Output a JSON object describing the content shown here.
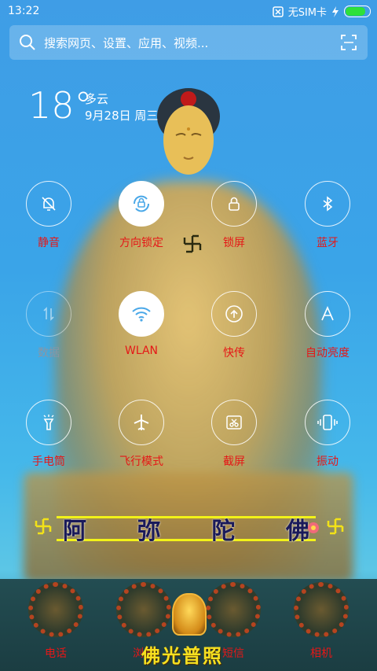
{
  "status_bar": {
    "time": "13:22",
    "sim": "无SIM卡",
    "battery_level": 0.9
  },
  "search": {
    "placeholder": "搜索网页、设置、应用、视频..."
  },
  "weather": {
    "temperature": "18°",
    "condition": "多云",
    "date": "9月28日 周三"
  },
  "toggles": [
    {
      "label": "静音",
      "icon": "bell-off-icon",
      "on": false
    },
    {
      "label": "方向锁定",
      "icon": "rotation-lock-icon",
      "on": true
    },
    {
      "label": "锁屏",
      "icon": "lock-icon",
      "on": false
    },
    {
      "label": "蓝牙",
      "icon": "bluetooth-icon",
      "on": false
    },
    {
      "label": "数据",
      "icon": "data-arrows-icon",
      "on": false
    },
    {
      "label": "WLAN",
      "icon": "wifi-icon",
      "on": true
    },
    {
      "label": "快传",
      "icon": "upload-icon",
      "on": false
    },
    {
      "label": "自动亮度",
      "icon": "auto-brightness-icon",
      "on": false
    },
    {
      "label": "手电筒",
      "icon": "flashlight-icon",
      "on": false
    },
    {
      "label": "飞行模式",
      "icon": "airplane-icon",
      "on": false
    },
    {
      "label": "截屏",
      "icon": "scissors-icon",
      "on": false
    },
    {
      "label": "振动",
      "icon": "vibrate-icon",
      "on": false
    }
  ],
  "mantra": {
    "chars": [
      "阿",
      "弥",
      "陀",
      "佛"
    ]
  },
  "dock": [
    {
      "label": "电话"
    },
    {
      "label": "浏览"
    },
    {
      "label": "短信"
    },
    {
      "label": "相机"
    }
  ],
  "dock_banner": "佛光普照",
  "colors": {
    "label_red": "#e51717",
    "mantra_yellow": "#f2f218",
    "dock_bg": "#234d52"
  }
}
